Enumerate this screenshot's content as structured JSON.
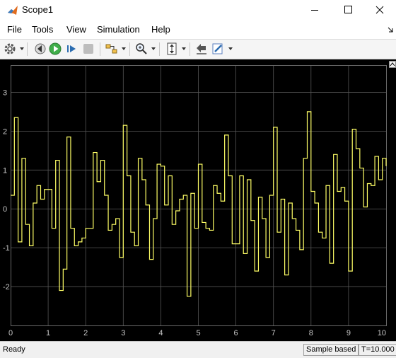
{
  "window": {
    "title": "Scope1"
  },
  "menu": [
    "File",
    "Tools",
    "View",
    "Simulation",
    "Help"
  ],
  "toolbar": {
    "icons": [
      "gear-icon",
      "step-back-icon",
      "run-icon",
      "step-forward-icon",
      "stop-icon",
      "highlight-block-icon",
      "zoom-icon",
      "scale-axes-icon",
      "restore-layout-icon",
      "style-icon"
    ]
  },
  "status": {
    "left": "Ready",
    "mode": "Sample based",
    "time": "T=10.000"
  },
  "colors": {
    "plot_bg": "#000000",
    "grid": "#555555",
    "trace": "#ffff66",
    "ticks": "#c8c8c8"
  },
  "chart_data": {
    "type": "line",
    "step": true,
    "xlim": [
      0,
      10
    ],
    "ylim": [
      -3,
      3.7
    ],
    "xticks": [
      0,
      1,
      2,
      3,
      4,
      5,
      6,
      7,
      8,
      9,
      10
    ],
    "yticks": [
      -2,
      -1,
      0,
      1,
      2,
      3
    ],
    "grid": true,
    "series": [
      {
        "x": [
          0,
          0.1,
          0.2,
          0.3,
          0.4,
          0.5,
          0.6,
          0.7,
          0.8,
          0.9,
          1.0,
          1.1,
          1.2,
          1.3,
          1.4,
          1.5,
          1.6,
          1.7,
          1.8,
          1.9,
          2.0,
          2.1,
          2.2,
          2.3,
          2.4,
          2.5,
          2.6,
          2.7,
          2.8,
          2.9,
          3.0,
          3.1,
          3.2,
          3.3,
          3.4,
          3.5,
          3.6,
          3.7,
          3.8,
          3.9,
          4.0,
          4.1,
          4.2,
          4.3,
          4.4,
          4.5,
          4.6,
          4.7,
          4.8,
          4.9,
          5.0,
          5.1,
          5.2,
          5.3,
          5.4,
          5.5,
          5.6,
          5.7,
          5.8,
          5.9,
          6.0,
          6.1,
          6.2,
          6.3,
          6.4,
          6.5,
          6.6,
          6.7,
          6.8,
          6.9,
          7.0,
          7.1,
          7.2,
          7.3,
          7.4,
          7.5,
          7.6,
          7.7,
          7.8,
          7.9,
          8.0,
          8.1,
          8.2,
          8.3,
          8.4,
          8.5,
          8.6,
          8.7,
          8.8,
          8.9,
          9.0,
          9.1,
          9.2,
          9.3,
          9.4,
          9.5,
          9.6,
          9.7,
          9.8,
          9.9,
          10.0
        ],
        "values": [
          0.35,
          2.35,
          -0.85,
          1.3,
          -0.4,
          -0.95,
          0.15,
          0.6,
          0.25,
          0.5,
          0.5,
          -0.5,
          1.25,
          -2.1,
          -1.55,
          1.85,
          -0.5,
          -0.95,
          -0.85,
          -0.75,
          -0.5,
          -0.5,
          1.45,
          0.7,
          1.25,
          0.35,
          -0.55,
          -0.4,
          -0.25,
          -1.25,
          2.15,
          0.85,
          -0.6,
          -0.95,
          1.3,
          0.75,
          0.1,
          -1.3,
          -0.25,
          1.15,
          1.1,
          0.1,
          0.85,
          -0.4,
          -0.05,
          0.25,
          0.35,
          -2.25,
          0.4,
          -0.5,
          1.15,
          -0.35,
          -0.5,
          -0.55,
          0.6,
          0.4,
          0.2,
          1.9,
          0.85,
          -0.9,
          -0.9,
          0.85,
          -1.15,
          0.75,
          -0.3,
          -1.6,
          0.3,
          -0.25,
          -1.25,
          0.35,
          2.1,
          -0.6,
          0.25,
          -1.7,
          0.15,
          -0.25,
          -0.55,
          -1.05,
          1.3,
          2.5,
          0.45,
          0.15,
          -0.6,
          -0.75,
          0.6,
          -1.4,
          1.4,
          0.45,
          0.55,
          0.2,
          -1.6,
          2.05,
          1.55,
          1.05,
          0.05,
          0.65,
          0.6,
          1.35,
          0.75,
          1.3,
          1.1
        ]
      }
    ]
  }
}
